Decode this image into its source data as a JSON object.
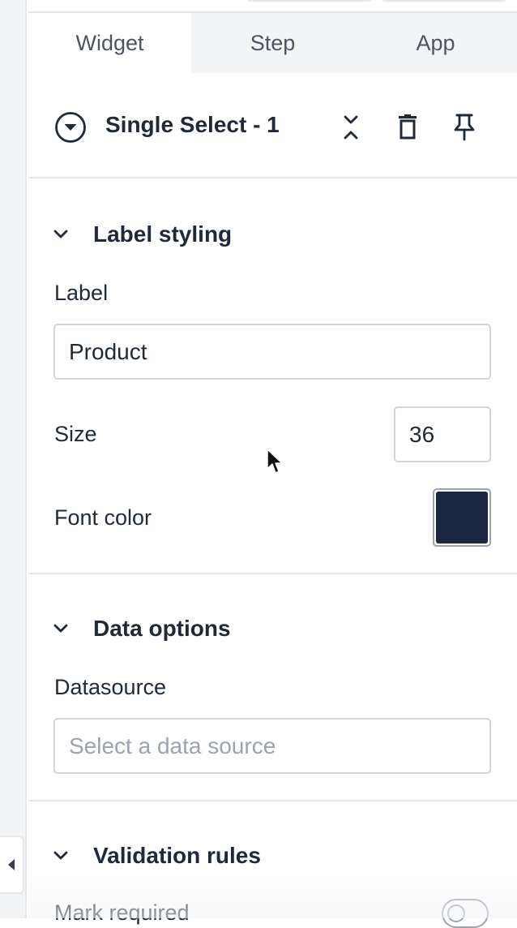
{
  "tabs": [
    {
      "label": "Widget",
      "active": true
    },
    {
      "label": "Step",
      "active": false
    },
    {
      "label": "App",
      "active": false
    }
  ],
  "header": {
    "title": "Single Select - 1",
    "icons": [
      "dropdown-circle-icon",
      "collapse-icon",
      "trash-icon",
      "pin-icon"
    ]
  },
  "label_styling": {
    "title": "Label styling",
    "label_field": {
      "label": "Label",
      "value": "Product"
    },
    "size_field": {
      "label": "Size",
      "value": "36"
    },
    "font_color": {
      "label": "Font color",
      "color": "#1b2640"
    }
  },
  "data_options": {
    "title": "Data options",
    "datasource": {
      "label": "Datasource",
      "value": "",
      "placeholder": "Select a data source"
    }
  },
  "validation_rules": {
    "title": "Validation rules",
    "mark_required": {
      "label": "Mark required",
      "on": false
    }
  },
  "colors": {
    "border": "#e5e7eb",
    "tab_bg": "#f3f4f6",
    "text": "#1f2937",
    "muted_text": "#4b5563"
  }
}
